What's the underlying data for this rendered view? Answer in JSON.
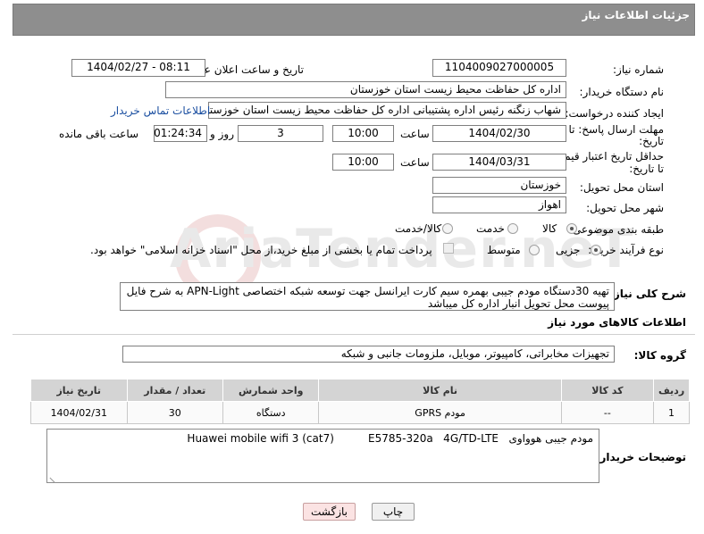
{
  "header": {
    "title": "جزئیات اطلاعات نیاز"
  },
  "watermark": {
    "text": "AriaTender.neT"
  },
  "form": {
    "need_number": {
      "label": "شماره نیاز:",
      "value": "1104009027000005"
    },
    "announce_datetime": {
      "label": "تاریخ و ساعت اعلان عمومی:",
      "value": "1404/02/27 - 08:11"
    },
    "buyer_org": {
      "label": "نام دستگاه خریدار:",
      "value": "اداره کل حفاظت محیط زیست استان خوزستان"
    },
    "requester": {
      "label": "ایجاد کننده درخواست:",
      "value": "شهاب زنگنه رئیس اداره پشتیبانی اداره کل حفاظت محیط زیست استان خوزستان",
      "contact_link": "اطلاعات تماس خریدار"
    },
    "response_deadline": {
      "label_line1": "مهلت ارسال پاسخ: تا",
      "label_line2": "تاریخ:",
      "date": "1404/02/30",
      "time_label": "ساعت",
      "time": "10:00",
      "days": "3",
      "days_label": "روز و",
      "remaining": "01:24:34",
      "remaining_label": "ساعت باقی مانده"
    },
    "price_validity": {
      "label_line1": "حداقل تاریخ اعتبار قیمت:",
      "label_line2": "تا تاریخ:",
      "date": "1404/03/31",
      "time_label": "ساعت",
      "time": "10:00"
    },
    "delivery_province": {
      "label": "استان محل تحویل:",
      "value": "خوزستان"
    },
    "delivery_city": {
      "label": "شهر محل تحویل:",
      "value": "اهواز"
    },
    "category": {
      "label": "طبقه بندی موضوعی:",
      "options": [
        "کالا",
        "خدمت",
        "کالا/خدمت"
      ],
      "selected": "کالا"
    },
    "process_type": {
      "label": "نوع فرآیند خرید :",
      "options": [
        "جزیی",
        "متوسط"
      ],
      "selected": "جزیی",
      "payment_note": "پرداخت تمام یا بخشی از مبلغ خرید،از محل \"اسناد خزانه اسلامی\" خواهد بود."
    },
    "general_description": {
      "label": "شرح کلی نیاز:",
      "value": "تهیه 30دستگاه مودم جیبی بهمره سیم کارت ایرانسل جهت توسعه شبکه اختصاصی APN-Light به شرح فایل پیوست محل تحویل انبار اداره کل میباشد"
    }
  },
  "goods_section": {
    "title": "اطلاعات کالاهای مورد نیاز",
    "group_label": "گروه کالا:",
    "group_value": "تجهیزات مخابراتی، کامپیوتر، موبایل، ملزومات جانبی و شبکه",
    "columns": [
      "ردیف",
      "کد کالا",
      "نام کالا",
      "واحد شمارش",
      "تعداد / مقدار",
      "تاریخ نیاز"
    ],
    "rows": [
      {
        "row": "1",
        "code": "--",
        "name": "مودم GPRS",
        "unit": "دستگاه",
        "qty": "30",
        "date": "1404/02/31"
      }
    ]
  },
  "buyer_notes": {
    "label": "توضیحات خریدار:",
    "value": "مودم جیبی هوواوی   Huawei mobile wifi 3 (cat7)          E5785-320a   4G/TD-LTE"
  },
  "buttons": {
    "print": "چاپ",
    "back": "بازگشت"
  },
  "colors": {
    "header_bg": "#8e8e8e",
    "link": "#1a4ea0",
    "back_button_bg": "#fbe3e3"
  }
}
